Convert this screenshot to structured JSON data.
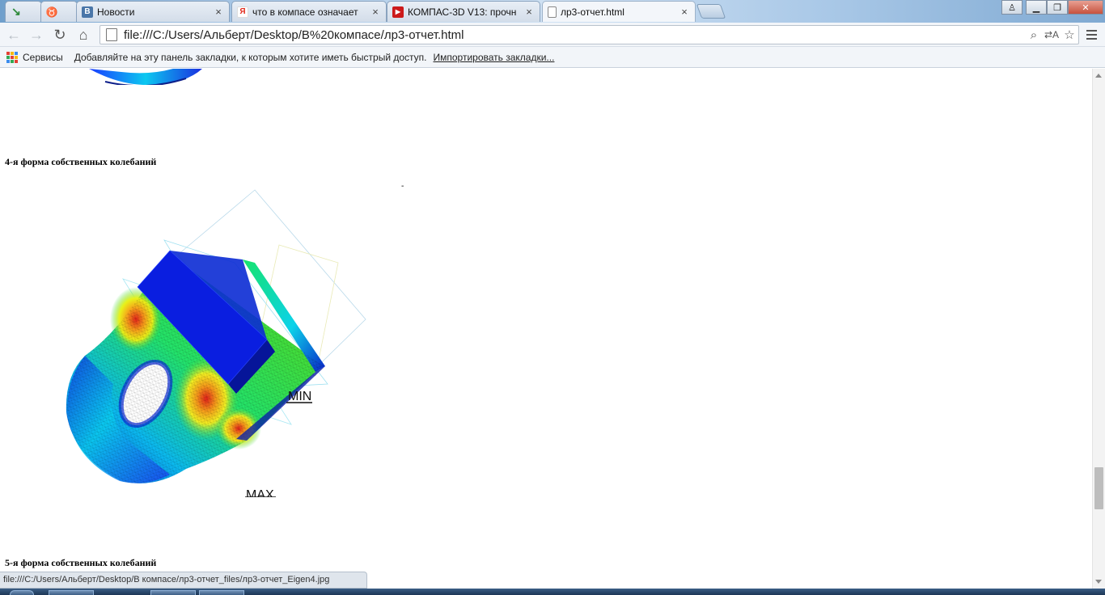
{
  "browser": {
    "tabs": [
      {
        "label": "",
        "favicon": "download-arrow-icon",
        "color": "#2d8a3a"
      },
      {
        "label": "",
        "favicon": "antivirus-icon",
        "color": "#c0272d"
      },
      {
        "label": "Новости",
        "favicon": "vk-icon",
        "color": "#4a76a8"
      },
      {
        "label": "что в компасе означает",
        "favicon": "yandex-icon",
        "color": "#e22b1d"
      },
      {
        "label": "КОМПАС-3D V13: прочн",
        "favicon": "youtube-icon",
        "color": "#cc1a1a"
      },
      {
        "label": "лр3-отчет.html",
        "favicon": "page-icon",
        "color": "#ffffff"
      }
    ],
    "window_controls": {
      "profile": "♙",
      "minimize": "▁",
      "restore": "❐",
      "close": "✕"
    },
    "url": "file:///C:/Users/Альберт/Desktop/В%20компасе/лр3-отчет.html",
    "bookmarks": {
      "apps_label": "Сервисы",
      "hint": "Добавляйте на эту панель закладки, к которым хотите иметь быстрый доступ.",
      "import_link": "Импортировать закладки..."
    },
    "status_url": "file:///C:/Users/Альберт/Desktop/В компасе/лр3-отчет_files/лр3-отчет_Eigen4.jpg"
  },
  "page": {
    "section4_title": "4-я форма собственных колебаний",
    "section5_title": "5-я форма собственных колебаний",
    "dash": "-",
    "figure": {
      "min_label": "MIN",
      "max_label": "MAX"
    }
  }
}
